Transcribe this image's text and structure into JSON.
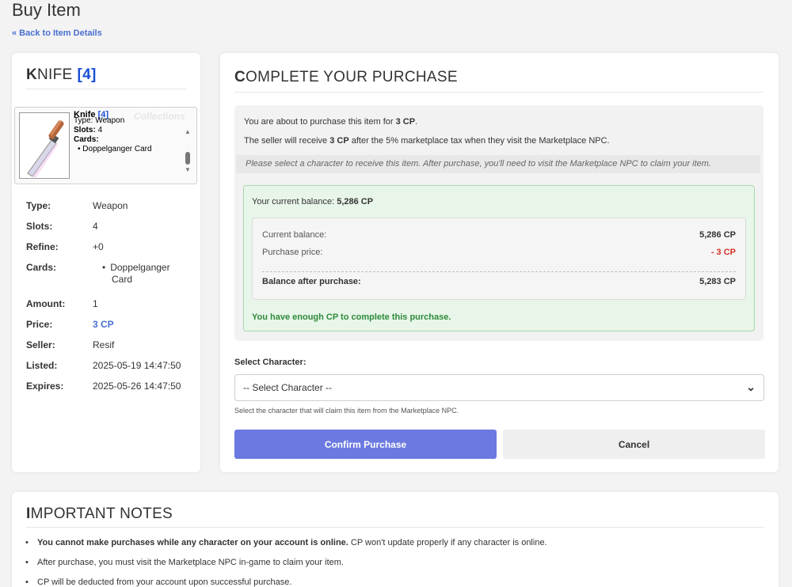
{
  "page": {
    "title": "Buy Item",
    "back_link": "« Back to Item Details"
  },
  "item": {
    "heading_first": "K",
    "heading_rest": "NIFE",
    "heading_slots": "[4]",
    "preview": {
      "name": "Knife",
      "slots": "[4]",
      "watermark": "Collections",
      "type_line": "Type: Weapon",
      "slots_label": "Slots:",
      "slots_value": "4",
      "cards_label": "Cards:",
      "card_name": "Doppelganger Card"
    },
    "details": {
      "type_label": "Type:",
      "type_value": "Weapon",
      "slots_label": "Slots:",
      "slots_value": "4",
      "refine_label": "Refine:",
      "refine_value": "+0",
      "cards_label": "Cards:",
      "cards_value": "Doppelganger Card",
      "amount_label": "Amount:",
      "amount_value": "1",
      "price_label": "Price:",
      "price_value": "3 CP",
      "seller_label": "Seller:",
      "seller_value": "Resif",
      "listed_label": "Listed:",
      "listed_value": "2025-05-19 14:47:50",
      "expires_label": "Expires:",
      "expires_value": "2025-05-26 14:47:50"
    }
  },
  "purchase": {
    "heading_first": "C",
    "heading_rest": "OMPLETE YOUR PURCHASE",
    "line1_prefix": "You are about to purchase this item for ",
    "line1_amount": "3 CP",
    "line1_suffix": ".",
    "line2_prefix": "The seller will receive ",
    "line2_amount": "3 CP",
    "line2_suffix": " after the 5% marketplace tax when they visit the Marketplace NPC.",
    "notice": "Please select a character to receive this item. After purchase, you'll need to visit the Marketplace NPC to claim your item.",
    "balance_title_prefix": "Your current balance: ",
    "balance_title_value": "5,286 CP",
    "current_balance_label": "Current balance:",
    "current_balance_value": "5,286 CP",
    "purchase_price_label": "Purchase price:",
    "purchase_price_value": "- 3 CP",
    "after_label": "Balance after purchase:",
    "after_value": "5,283 CP",
    "enough_message": "You have enough CP to complete this purchase.",
    "select_label": "Select Character:",
    "select_value": "-- Select Character --",
    "select_help": "Select the character that will claim this item from the Marketplace NPC.",
    "confirm_button": "Confirm Purchase",
    "cancel_button": "Cancel"
  },
  "notes": {
    "heading_first": "I",
    "heading_rest": "MPORTANT NOTES",
    "note1_bold": "You cannot make purchases while any character on your account is online.",
    "note1_rest": " CP won't update properly if any character is online.",
    "note2": "After purchase, you must visit the Marketplace NPC in-game to claim your item.",
    "note3": "CP will be deducted from your account upon successful purchase."
  },
  "colors": {
    "accent": "#6b79e0",
    "link": "#4a6fd0",
    "success": "#2e8b3a",
    "negative": "#d93025"
  }
}
